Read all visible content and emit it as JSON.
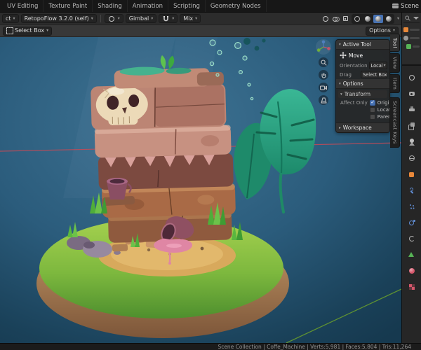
{
  "topbar": {
    "workspaces": [
      "UV Editing",
      "Texture Paint",
      "Shading",
      "Animation",
      "Scripting",
      "Geometry Nodes"
    ],
    "scene_selector_label": "Scene"
  },
  "viewport_header": {
    "mode_fragment": "ct",
    "retopoflow_label": "RetopoFlow 3.2.0 (self)",
    "orientation": "Gimbal",
    "blend_mode": "Mix"
  },
  "tool_settings": {
    "active_tool": "Select Box",
    "options": "Options"
  },
  "viewport": {
    "shading": [
      {
        "name": "wireframe"
      },
      {
        "name": "solid"
      },
      {
        "name": "material-preview",
        "active": true
      },
      {
        "name": "rendered"
      }
    ],
    "nav_buttons": [
      "zoom",
      "pan",
      "camera",
      "perspective"
    ]
  },
  "sidebar": {
    "tabs": [
      {
        "label": "Tool",
        "active": true
      },
      {
        "label": "View"
      },
      {
        "label": "Item"
      },
      {
        "label": "Screencast Keys",
        "tall": true
      }
    ],
    "active_tool_title": "Active Tool",
    "tool_name": "Move",
    "orientation_label": "Orientation",
    "orientation_value": "Local",
    "drag_label": "Drag",
    "drag_value": "Select Box",
    "options_title": "Options",
    "transform_title": "Transform",
    "affect_only_label": "Affect Only",
    "affect_checkboxes": [
      {
        "label": "Origins",
        "checked": true
      },
      {
        "label": "Locations"
      },
      {
        "label": "Parents"
      }
    ],
    "workspace_title": "Workspace"
  },
  "properties_tabs": [
    {
      "name": "tool",
      "color": "#c0c0c0",
      "shape": "ring"
    },
    {
      "name": "render",
      "color": "#ababab",
      "shape": "camera"
    },
    {
      "name": "output",
      "color": "#ababab",
      "shape": "printer"
    },
    {
      "name": "view-layer",
      "color": "#ababab",
      "shape": "stack"
    },
    {
      "name": "scene",
      "color": "#c0c0c0",
      "shape": "scene"
    },
    {
      "name": "world",
      "color": "#ababab",
      "shape": "globe"
    },
    {
      "name": "object",
      "color": "#e8883a",
      "shape": "square"
    },
    {
      "name": "modifiers",
      "color": "#628fd6",
      "shape": "wrench"
    },
    {
      "name": "particles",
      "color": "#628fd6",
      "shape": "dots"
    },
    {
      "name": "physics",
      "color": "#628fd6",
      "shape": "orbit"
    },
    {
      "name": "constraints",
      "color": "#b0b0b0",
      "shape": "clamp"
    },
    {
      "name": "object-data",
      "color": "#57b356",
      "shape": "triangle"
    },
    {
      "name": "material",
      "color": "#d4566a",
      "shape": "sphere"
    },
    {
      "name": "texture",
      "color": "#d4566a",
      "shape": "checker"
    }
  ],
  "statusbar": {
    "text": "Scene Collection | Coffe_Machine | Verts:5,981 | Faces:5,804 | Tris:11,264"
  },
  "colors": {
    "accent_blue": "#4772b3",
    "axis_x_red": "#c04b58",
    "axis_y_green": "#5f9232",
    "water_deep": "#16394f",
    "water_light": "#3f7494",
    "island_grass": "#7db83e",
    "sand": "#d8a95c",
    "stone_pink": "#c18b7c",
    "stone_dark": "#7c4a40",
    "leaf_teal": "#2aa183",
    "skull_bone": "#ecdab8",
    "pot_maroon": "#8f5062",
    "spill_pink": "#df86a4"
  }
}
